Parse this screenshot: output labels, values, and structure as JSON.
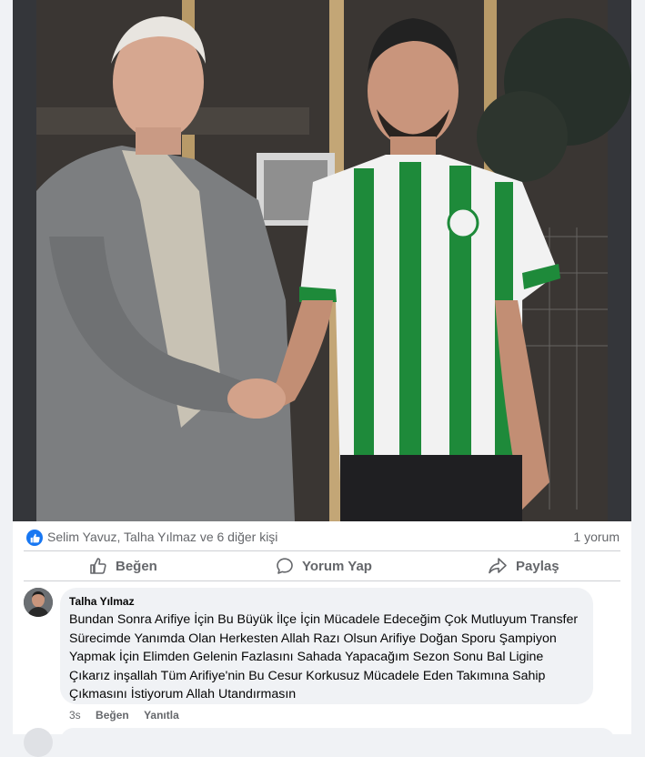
{
  "post": {
    "photo_alt": "",
    "reactions": {
      "reactors_text": "Selim Yavuz, Talha Yılmaz ve 6 diğer kişi",
      "comment_count_text": "1 yorum"
    },
    "actions": {
      "like_label": "Beğen",
      "comment_label": "Yorum Yap",
      "share_label": "Paylaş"
    }
  },
  "comment": {
    "author": "Talha Yılmaz",
    "text": "Bundan Sonra Arifiye İçin Bu Büyük İlçe İçin Mücadele Edeceğim Çok Mutluyum Transfer Sürecimde Yanımda Olan Herkesten Allah Razı Olsun Arifiye Doğan Sporu Şampiyon Yapmak İçin Elimden Gelenin Fazlasını Sahada Yapacağım Sezon Sonu Bal Ligine Çıkarız inşallah Tüm Arifiye'nin Bu Cesur Korkusuz Mücadele Eden Takımına Sahip Çıkmasını İstiyorum Allah Utandırmasın",
    "time": "3s",
    "like_label": "Beğen",
    "reply_label": "Yanıtla"
  },
  "colors": {
    "accent": "#1877f2",
    "secondary_text": "#65676b",
    "bubble": "#f0f2f5",
    "jersey_green": "#1e8a3a"
  }
}
